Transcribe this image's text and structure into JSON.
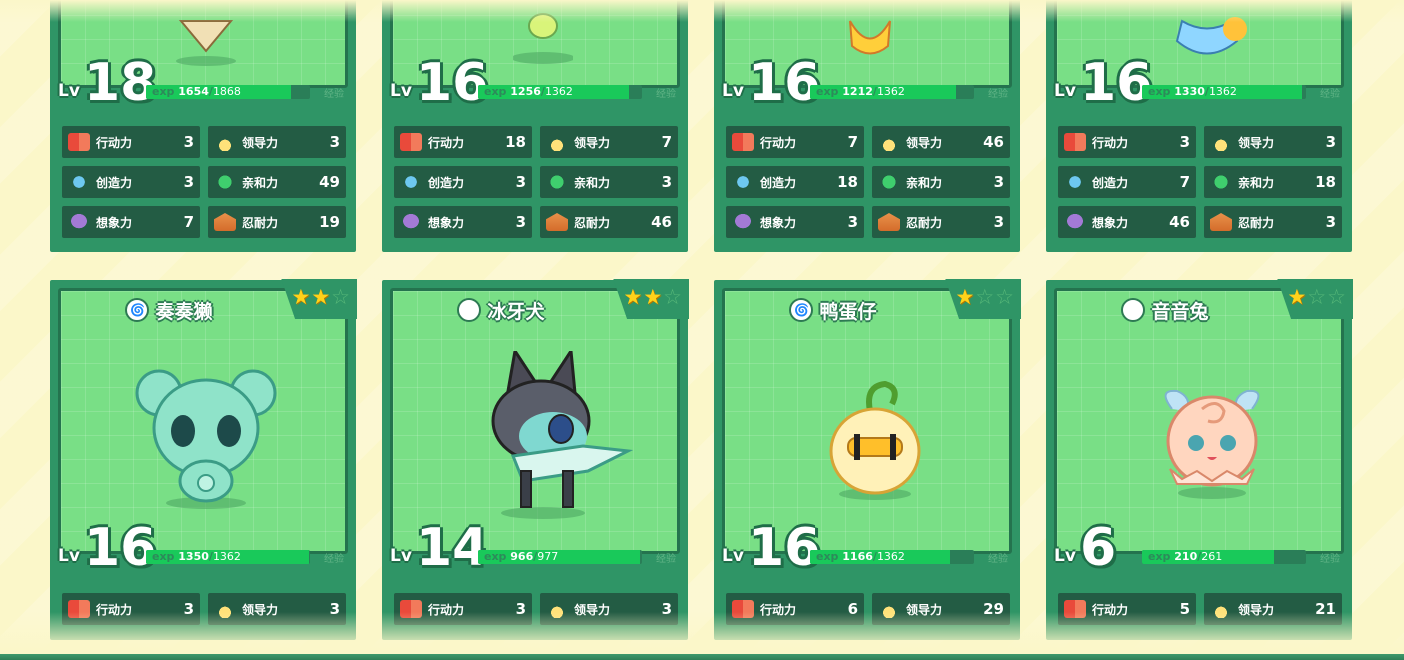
{
  "lv_label": "Lv",
  "exp_label": "exp",
  "exp_button_label": "经验",
  "stat_labels": {
    "action": "行动力",
    "leadership": "领导力",
    "creativity": "创造力",
    "affinity": "亲和力",
    "imagination": "想象力",
    "endurance": "忍耐力"
  },
  "colors": {
    "card": "#2f9566",
    "art": "#79df86",
    "stat_bg": "#235c44",
    "exp_fill": "#19c95a",
    "star": "#ffd21a"
  },
  "top_row": [
    {
      "level": "18",
      "exp": "1654",
      "exp_max": "1868",
      "exp_fraction": 0.885,
      "action": "3",
      "leadership": "3",
      "creativity": "3",
      "affinity": "49",
      "imagination": "7",
      "endurance": "19"
    },
    {
      "level": "16",
      "exp": "1256",
      "exp_max": "1362",
      "exp_fraction": 0.922,
      "action": "18",
      "leadership": "7",
      "creativity": "3",
      "affinity": "3",
      "imagination": "3",
      "endurance": "46"
    },
    {
      "level": "16",
      "exp": "1212",
      "exp_max": "1362",
      "exp_fraction": 0.89,
      "action": "7",
      "leadership": "46",
      "creativity": "18",
      "affinity": "3",
      "imagination": "3",
      "endurance": "3"
    },
    {
      "level": "16",
      "exp": "1330",
      "exp_max": "1362",
      "exp_fraction": 0.976,
      "action": "3",
      "leadership": "3",
      "creativity": "7",
      "affinity": "18",
      "imagination": "46",
      "endurance": "3"
    }
  ],
  "bottom_row": [
    {
      "name": "奏奏獭",
      "element_icon": "water-swirl-icon",
      "stars": 2,
      "level": "16",
      "exp": "1350",
      "exp_max": "1362",
      "exp_fraction": 0.991,
      "action": "3",
      "leadership": "3"
    },
    {
      "name": "冰牙犬",
      "element_icon": "ice-snowflake-icon",
      "stars": 2,
      "level": "14",
      "exp": "966",
      "exp_max": "977",
      "exp_fraction": 0.989,
      "action": "3",
      "leadership": "3"
    },
    {
      "name": "鸭蛋仔",
      "element_icon": "water-swirl-icon",
      "stars": 1,
      "level": "16",
      "exp": "1166",
      "exp_max": "1362",
      "exp_fraction": 0.856,
      "action": "6",
      "leadership": "29"
    },
    {
      "name": "音音兔",
      "element_icon": "fairy-flower-icon",
      "stars": 1,
      "level": "6",
      "exp": "210",
      "exp_max": "261",
      "exp_fraction": 0.805,
      "action": "5",
      "leadership": "21"
    }
  ]
}
